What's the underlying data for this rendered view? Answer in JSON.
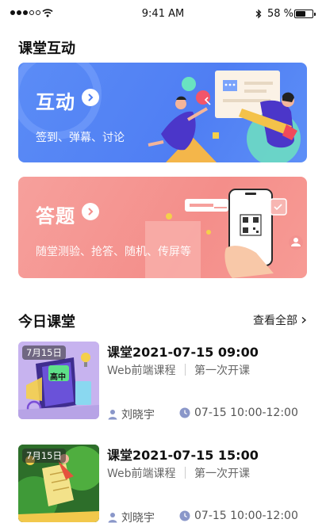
{
  "status_bar": {
    "time": "9:41 AM",
    "battery_text": "58 %",
    "battery_level": 0.58,
    "bluetooth_icon": "bluetooth-icon",
    "wifi_icon": "wifi-icon"
  },
  "interaction_section": {
    "title": "课堂互动"
  },
  "cards": [
    {
      "title": "互动",
      "subtitle": "签到、弹幕、讨论",
      "color": "#5b8cf6",
      "arrow_icon": "chevron-right-icon"
    },
    {
      "title": "答题",
      "subtitle": "随堂测验、抢答、随机、传屏等",
      "color": "#f6a09c",
      "arrow_icon": "chevron-right-icon"
    }
  ],
  "today": {
    "title": "今日课堂",
    "more_label": "查看全部",
    "more_icon": "chevron-right-icon"
  },
  "lessons": [
    {
      "date_badge": "7月15日",
      "thumb_label": "高中",
      "title": "课堂2021-07-15 09:00",
      "course": "Web前端课程",
      "session": "第一次开课",
      "teacher": "刘晓宇",
      "time": "07-15 10:00-12:00"
    },
    {
      "date_badge": "7月15日",
      "title": "课堂2021-07-15 15:00",
      "course": "Web前端课程",
      "session": "第一次开课",
      "teacher": "刘晓宇",
      "time": "07-15 10:00-12:00"
    }
  ]
}
